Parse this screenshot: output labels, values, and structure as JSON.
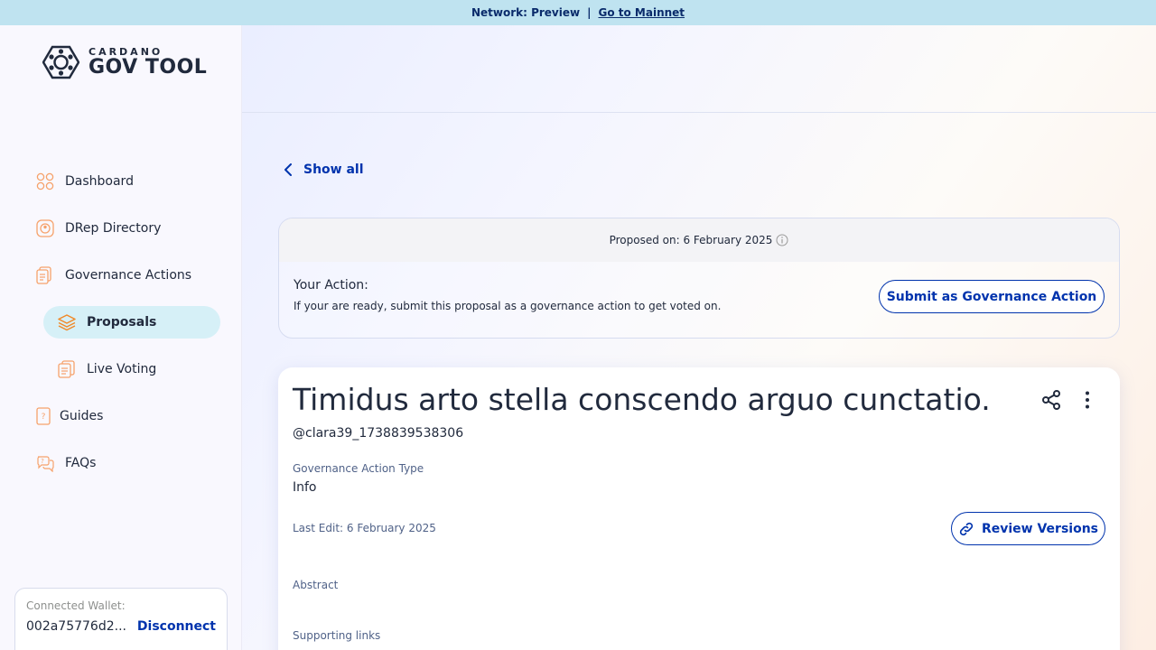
{
  "banner": {
    "network_text": "Network: Preview",
    "separator": "|",
    "mainnet_link": "Go to Mainnet"
  },
  "logo": {
    "small_text": "CARDANO",
    "big_text": "GOV TOOL"
  },
  "sidebar": {
    "items": [
      {
        "label": "Dashboard",
        "icon": "dashboard-icon"
      },
      {
        "label": "DRep Directory",
        "icon": "drep-icon"
      },
      {
        "label": "Governance Actions",
        "icon": "governance-icon"
      },
      {
        "label": "Proposals",
        "icon": "proposals-icon"
      },
      {
        "label": "Live Voting",
        "icon": "live-voting-icon"
      },
      {
        "label": "Guides",
        "icon": "guides-icon"
      },
      {
        "label": "FAQs",
        "icon": "faqs-icon"
      }
    ]
  },
  "wallet": {
    "label": "Connected Wallet:",
    "address": "002a75776d2...",
    "disconnect": "Disconnect"
  },
  "nav_back": {
    "label": "Show all"
  },
  "action_card": {
    "proposed_on": "Proposed on: 6 February 2025",
    "title": "Your Action:",
    "description": "If your are ready, submit this proposal as a governance action to get voted on.",
    "submit_button": "Submit as Governance Action"
  },
  "proposal": {
    "title": "Timidus arto stella conscendo arguo cunctatio.",
    "author": "@clara39_1738839538306",
    "type_label": "Governance Action Type",
    "type_value": "Info",
    "last_edit": "Last Edit: 6 February 2025",
    "review_button": "Review Versions",
    "abstract_label": "Abstract",
    "links_label": "Supporting links"
  },
  "colors": {
    "accent": "#0033ad",
    "icon_orange": "#f6a26b",
    "active_nav_bg": "#d6f0f7",
    "banner_bg": "#bfe3f0"
  }
}
